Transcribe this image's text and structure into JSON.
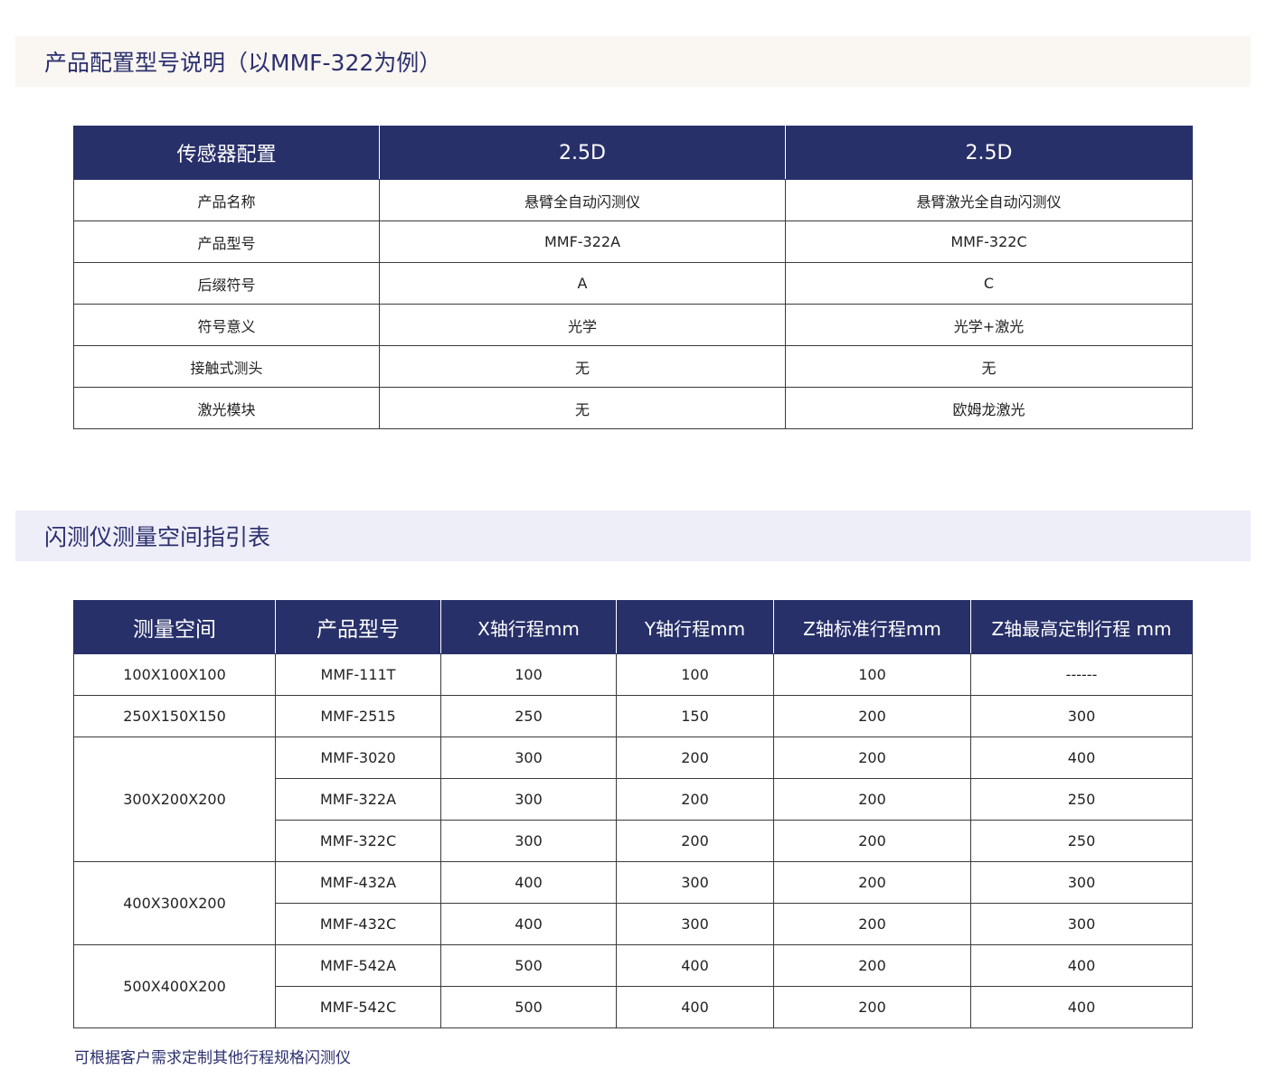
{
  "section1": {
    "title": "产品配置型号说明（以MMF-322为例）",
    "headers": [
      "传感器配置",
      "2.5D",
      "2.5D"
    ],
    "rows": [
      [
        "产品名称",
        "悬臂全自动闪测仪",
        "悬臂激光全自动闪测仪"
      ],
      [
        "产品型号",
        "MMF-322A",
        "MMF-322C"
      ],
      [
        "后缀符号",
        "A",
        "C"
      ],
      [
        "符号意义",
        "光学",
        "光学+激光"
      ],
      [
        "接触式测头",
        "无",
        "无"
      ],
      [
        "激光模块",
        "无",
        "欧姆龙激光"
      ]
    ]
  },
  "section2": {
    "title": "闪测仪测量空间指引表",
    "headers": [
      "测量空间",
      "产品型号",
      "X轴行程mm",
      "Y轴行程mm",
      "Z轴标准行程mm",
      "Z轴最高定制行程 mm"
    ],
    "groups": [
      {
        "space": "100X100X100",
        "rows": [
          [
            "MMF-111T",
            "100",
            "100",
            "100",
            "------"
          ]
        ]
      },
      {
        "space": "250X150X150",
        "rows": [
          [
            "MMF-2515",
            "250",
            "150",
            "200",
            "300"
          ]
        ]
      },
      {
        "space": "300X200X200",
        "rows": [
          [
            "MMF-3020",
            "300",
            "200",
            "200",
            "400"
          ],
          [
            "MMF-322A",
            "300",
            "200",
            "200",
            "250"
          ],
          [
            "MMF-322C",
            "300",
            "200",
            "200",
            "250"
          ]
        ]
      },
      {
        "space": "400X300X200",
        "rows": [
          [
            "MMF-432A",
            "400",
            "300",
            "200",
            "300"
          ],
          [
            "MMF-432C",
            "400",
            "300",
            "200",
            "300"
          ]
        ]
      },
      {
        "space": "500X400X200",
        "rows": [
          [
            "MMF-542A",
            "500",
            "400",
            "200",
            "400"
          ],
          [
            "MMF-542C",
            "500",
            "400",
            "200",
            "400"
          ]
        ]
      }
    ],
    "footnote": "可根据客户需求定制其他行程规格闪测仪"
  },
  "colors": {
    "header_bg": "#283069",
    "title_text": "#2b2f6e",
    "banner1_bg": "#faf7f2",
    "banner2_bg": "#eeeef8"
  }
}
